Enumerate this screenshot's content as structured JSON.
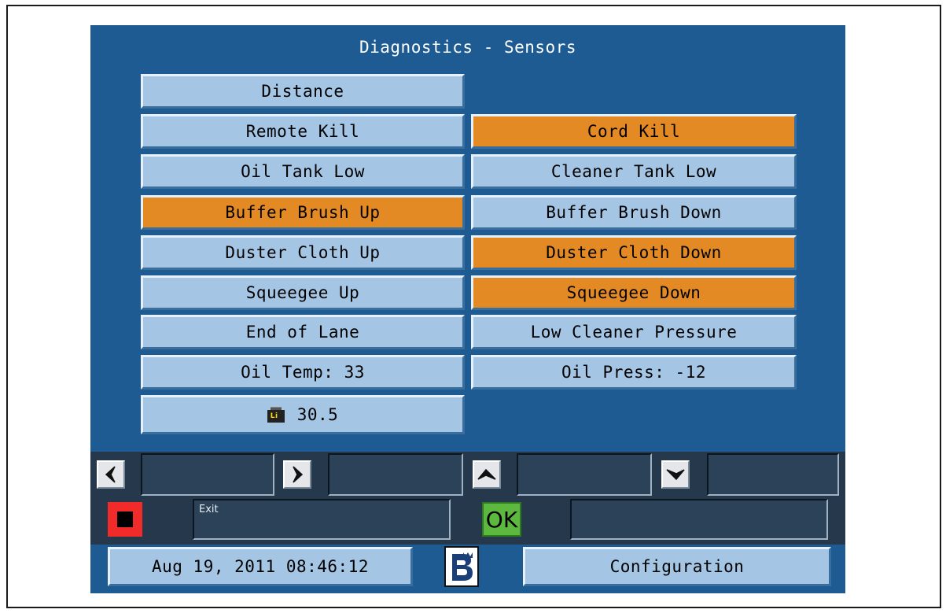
{
  "screen": {
    "title": "Diagnostics - Sensors"
  },
  "sensors": {
    "distance": "Distance",
    "remote_kill": "Remote Kill",
    "cord_kill": "Cord Kill",
    "oil_tank_low": "Oil Tank Low",
    "cleaner_tank_low": "Cleaner Tank Low",
    "buffer_brush_up": "Buffer Brush Up",
    "buffer_brush_down": "Buffer Brush Down",
    "duster_cloth_up": "Duster Cloth Up",
    "duster_cloth_down": "Duster Cloth Down",
    "squeegee_up": "Squeegee Up",
    "squeegee_down": "Squeegee Down",
    "end_of_lane": "End of Lane",
    "low_cleaner_pressure": "Low Cleaner Pressure",
    "oil_temp": "Oil Temp: 33",
    "oil_press": "Oil Press: -12",
    "battery_value": "30.5",
    "battery_icon_text": "Li"
  },
  "active_sensors": [
    "cord_kill",
    "buffer_brush_up",
    "duster_cloth_down",
    "squeegee_down"
  ],
  "colors": {
    "active": "#e38a25",
    "inactive": "#a4c6e4",
    "screen_bg": "#1f5b93"
  },
  "controls": {
    "exit_label": "Exit",
    "ok_label": "OK",
    "icons": [
      "left-arrow-icon",
      "right-arrow-icon",
      "up-arrow-icon",
      "down-arrow-icon",
      "stop-icon"
    ]
  },
  "footer": {
    "datetime": "Aug 19, 2011 08:46:12",
    "configuration": "Configuration"
  }
}
